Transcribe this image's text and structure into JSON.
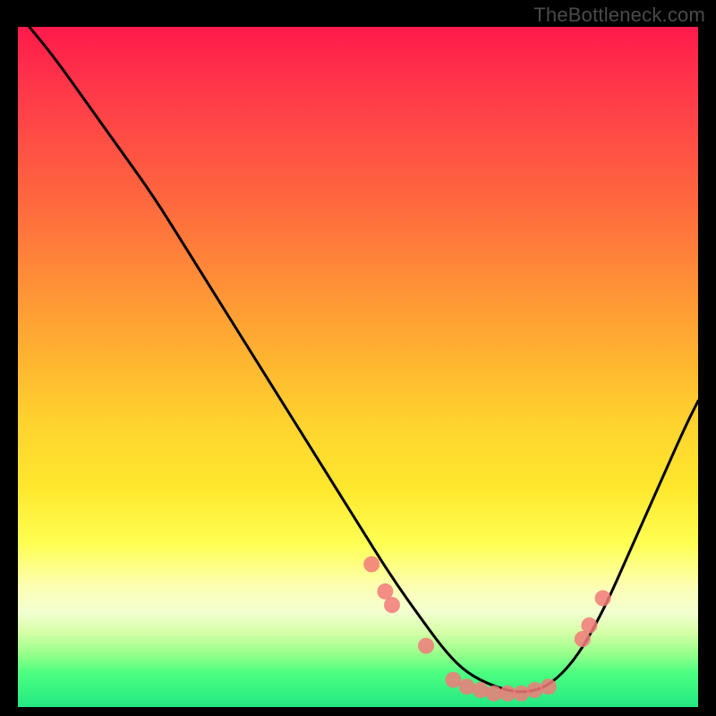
{
  "watermark": "TheBottleneck.com",
  "chart_data": {
    "type": "line",
    "title": "",
    "xlabel": "",
    "ylabel": "",
    "xlim": [
      0,
      100
    ],
    "ylim": [
      0,
      100
    ],
    "series": [
      {
        "name": "bottleneck-curve",
        "x": [
          0,
          5,
          10,
          15,
          20,
          25,
          30,
          35,
          40,
          45,
          50,
          55,
          60,
          63,
          66,
          70,
          74,
          78,
          82,
          86,
          90,
          94,
          98,
          100
        ],
        "y": [
          102,
          96,
          89,
          82,
          75,
          67,
          59,
          51,
          43,
          35,
          27,
          19,
          12,
          8,
          5,
          3,
          2,
          3,
          7,
          14,
          23,
          32,
          41,
          45
        ]
      }
    ],
    "markers": [
      {
        "x": 52,
        "y": 21
      },
      {
        "x": 54,
        "y": 17
      },
      {
        "x": 55,
        "y": 15
      },
      {
        "x": 60,
        "y": 9
      },
      {
        "x": 64,
        "y": 4
      },
      {
        "x": 66,
        "y": 3
      },
      {
        "x": 68,
        "y": 2.5
      },
      {
        "x": 70,
        "y": 2
      },
      {
        "x": 72,
        "y": 2
      },
      {
        "x": 74,
        "y": 2
      },
      {
        "x": 76,
        "y": 2.5
      },
      {
        "x": 78,
        "y": 3
      },
      {
        "x": 83,
        "y": 10
      },
      {
        "x": 84,
        "y": 12
      },
      {
        "x": 86,
        "y": 16
      }
    ],
    "marker_radius": 9
  },
  "colors": {
    "background": "#000000",
    "curve": "#000000",
    "marker": "#f27a7a",
    "watermark": "#4a4a4a"
  }
}
